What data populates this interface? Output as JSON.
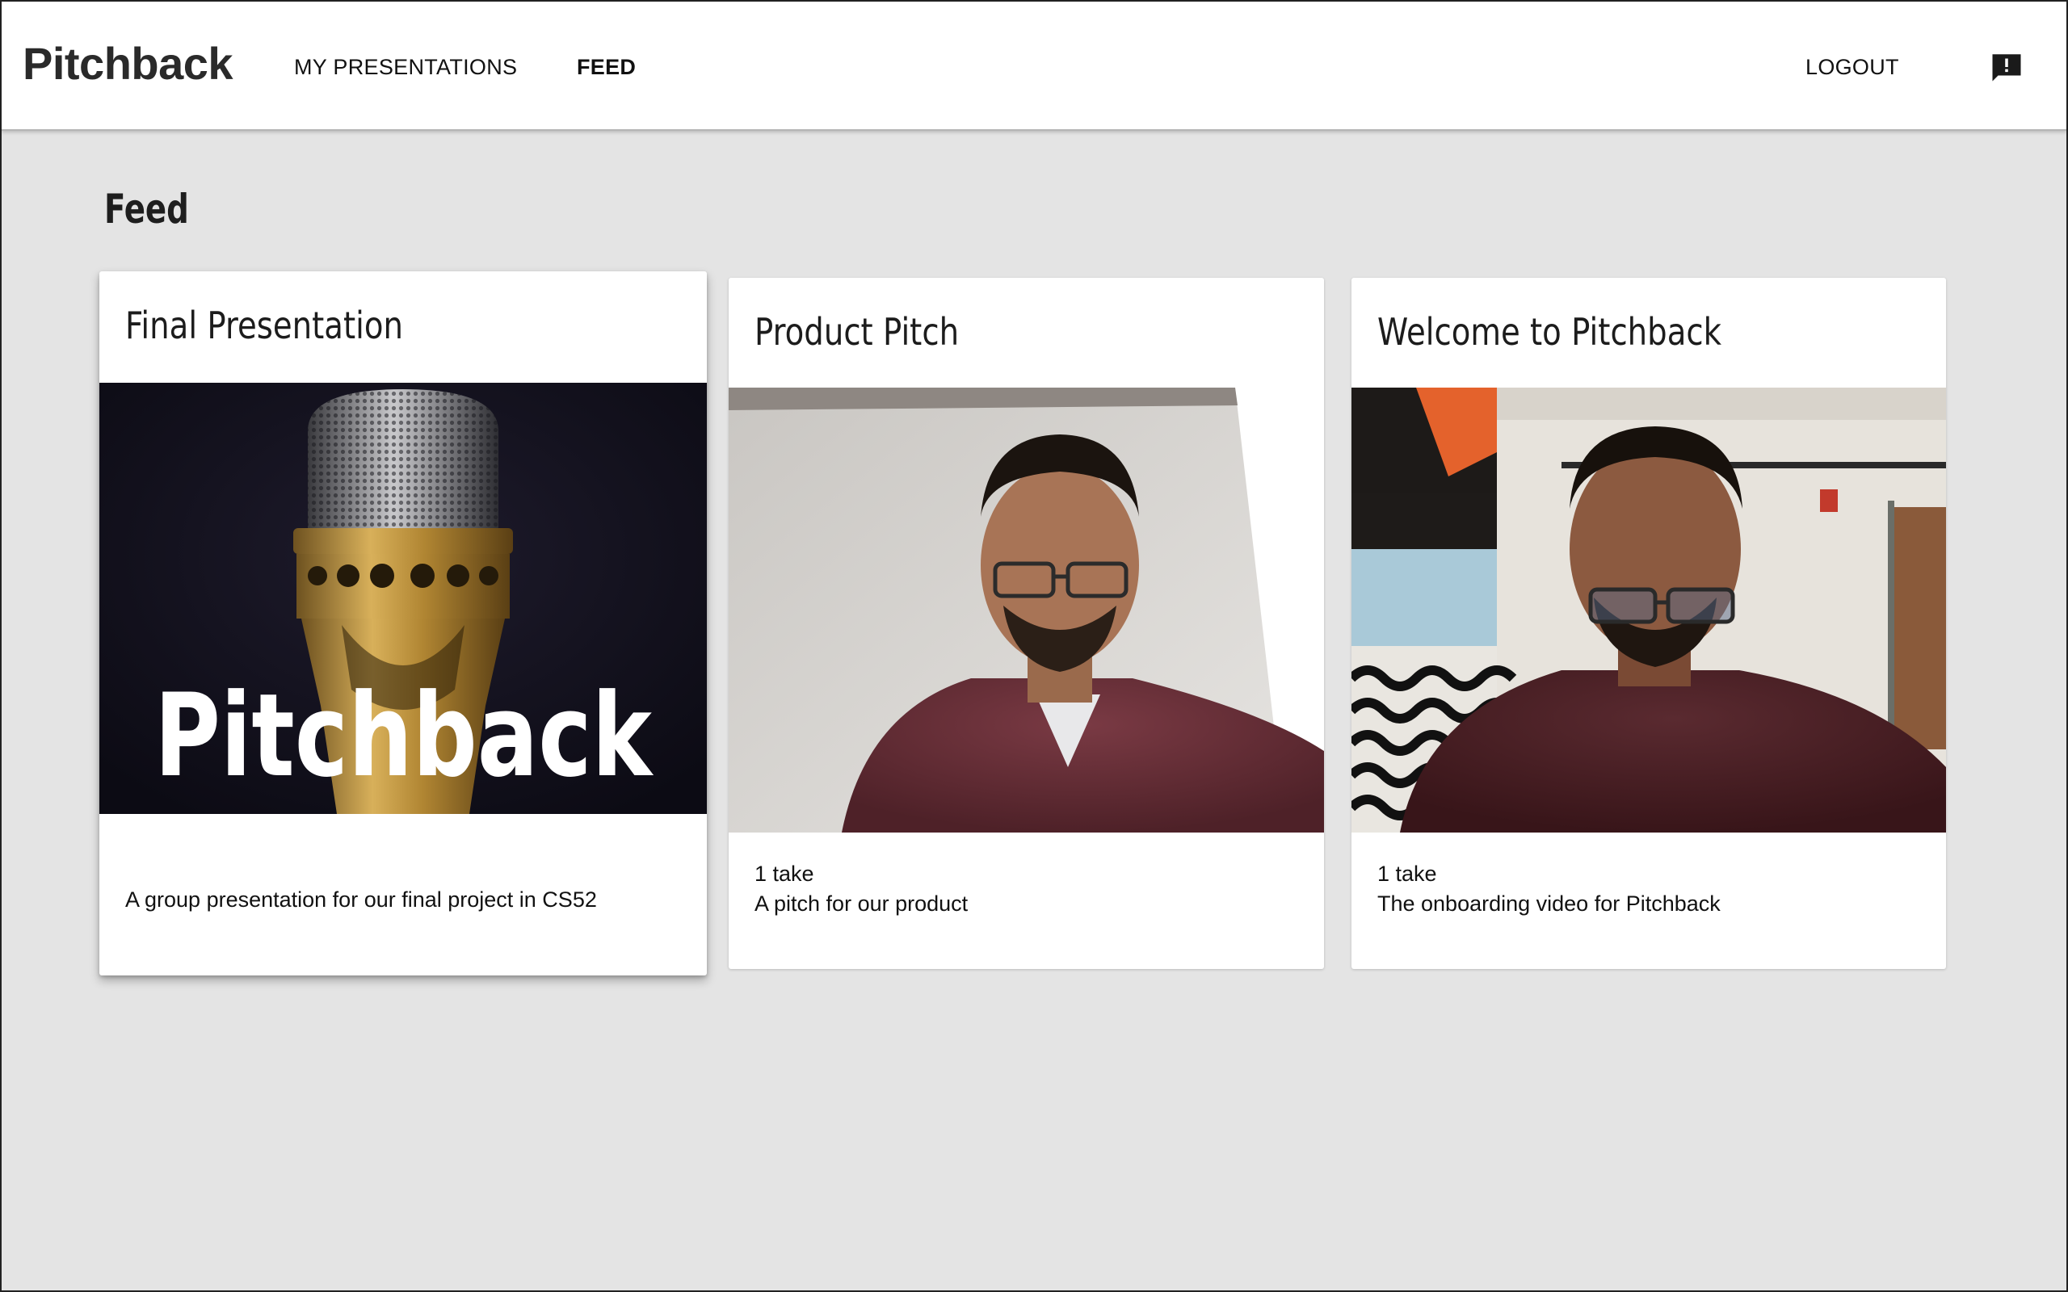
{
  "header": {
    "brand": "Pitchback",
    "nav": {
      "my_presentations": "MY PRESENTATIONS",
      "feed": "FEED",
      "logout": "LOGOUT"
    },
    "feedback_icon": "feedback-icon"
  },
  "page": {
    "title": "Feed"
  },
  "cards": [
    {
      "title": "Final Presentation",
      "thumbnail_text": "Pitchback",
      "takes": "",
      "description": "A group presentation for our final project in CS52"
    },
    {
      "title": "Product Pitch",
      "takes": "1 take",
      "description": "A pitch for our product"
    },
    {
      "title": "Welcome to Pitchback",
      "takes": "1 take",
      "description": "The onboarding video for Pitchback"
    }
  ],
  "colors": {
    "background": "#e4e4e4",
    "card": "#ffffff",
    "mic_gold": "#b8903a",
    "thumbnail_dark": "#14121e"
  }
}
